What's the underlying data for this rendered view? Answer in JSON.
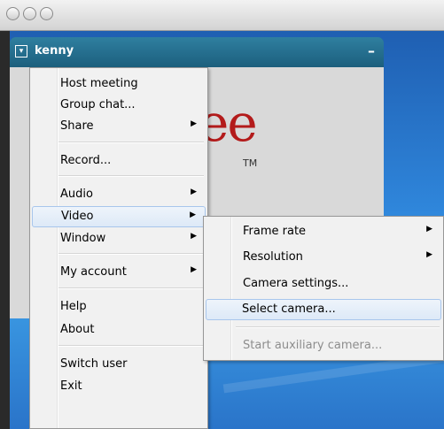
{
  "app": {
    "title": "kenny",
    "menu_glyph": "▾",
    "minimize_glyph": "–",
    "logo_text": "ee",
    "logo_tm": "TM"
  },
  "main_menu": {
    "items": [
      {
        "label": "Host meeting"
      },
      {
        "label": "Group chat..."
      },
      {
        "label": "Share",
        "submenu": true
      },
      {
        "label": "Record..."
      },
      {
        "label": "Audio",
        "submenu": true
      },
      {
        "label": "Video",
        "submenu": true,
        "highlighted": true
      },
      {
        "label": "Window",
        "submenu": true
      },
      {
        "label": "My account",
        "submenu": true
      },
      {
        "label": "Help"
      },
      {
        "label": "About"
      },
      {
        "label": "Switch user"
      },
      {
        "label": "Exit"
      }
    ]
  },
  "video_submenu": {
    "items": [
      {
        "label": "Frame rate",
        "submenu": true
      },
      {
        "label": "Resolution",
        "submenu": true
      },
      {
        "label": "Camera settings..."
      },
      {
        "label": "Select camera...",
        "highlighted": true
      },
      {
        "label": "Start auxiliary camera...",
        "disabled": true
      }
    ]
  },
  "icons": {
    "submenu_arrow": "▶"
  }
}
